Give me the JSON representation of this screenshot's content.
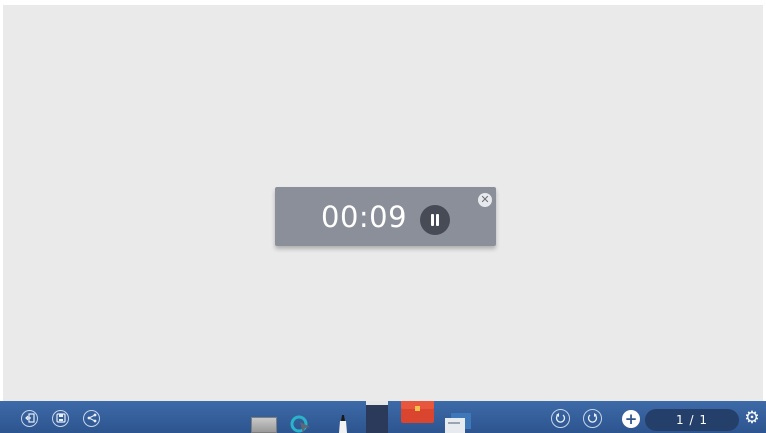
{
  "timer": {
    "time": "00:09",
    "pause_icon": "pause-icon",
    "close_icon": "close-icon"
  },
  "toolbar": {
    "left_icons": [
      "exit-icon",
      "save-icon",
      "share-icon"
    ],
    "tools": [
      "shape-tool-icon",
      "select-tool-icon",
      "pen-tool-icon",
      "eraser-tool-icon",
      "toolbox-icon",
      "cards-tool-icon"
    ],
    "undo_icon": "undo-icon",
    "redo_icon": "redo-icon",
    "add_page_label": "+",
    "page_indicator": "1 / 1",
    "settings_icon": "gear-icon"
  },
  "colors": {
    "canvas": "#eaeaea",
    "toolbar": "#2d558f",
    "timer_bg": "#8a8f9a",
    "pause_button": "#474b56"
  }
}
